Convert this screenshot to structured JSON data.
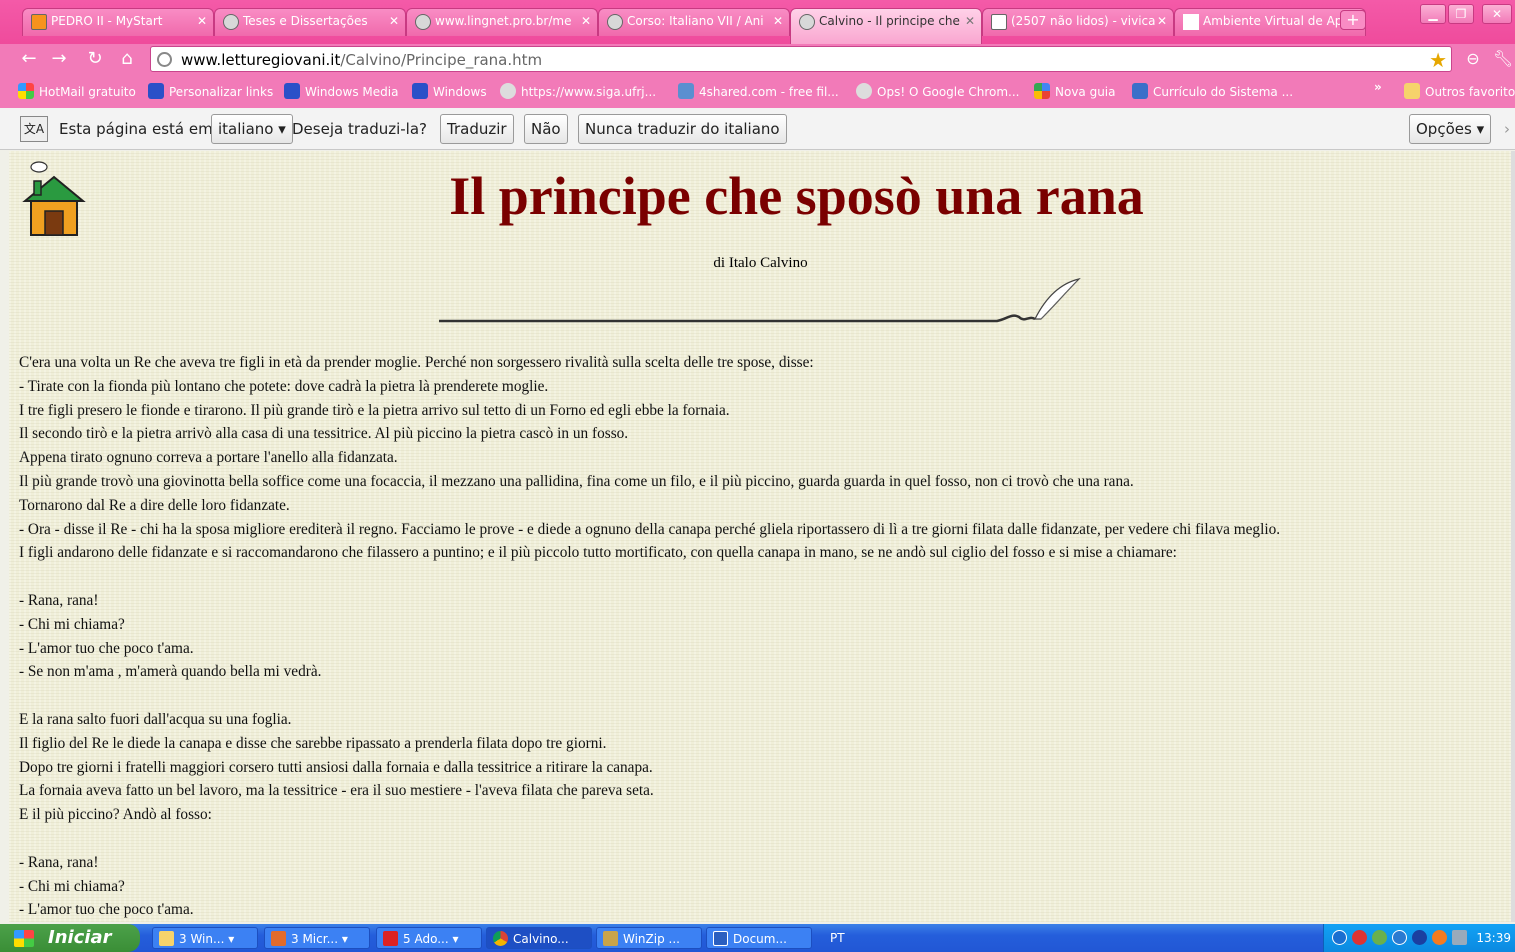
{
  "browser": {
    "tabs": [
      {
        "label": "PEDRO II - MyStart",
        "active": false
      },
      {
        "label": "Teses e Dissertações",
        "active": false
      },
      {
        "label": "www.lingnet.pro.br/me",
        "active": false
      },
      {
        "label": "Corso: Italiano VII / Ani",
        "active": false
      },
      {
        "label": "Calvino - Il principe che",
        "active": true
      },
      {
        "label": "(2507 não lidos) - vivica",
        "active": false
      },
      {
        "label": "Ambiente Virtual de Apr",
        "active": false
      }
    ],
    "url_domain": "www.letturegiovani.it",
    "url_path": "/Calvino/Principe_rana.htm",
    "bookmarks": [
      "HotMail gratuito",
      "Personalizar links",
      "Windows Media",
      "Windows",
      "https://www.siga.ufrj...",
      "4shared.com - free fil...",
      "Ops! O Google Chrom...",
      "Nova guia",
      "Currículo do Sistema ...",
      "Outros favoritos"
    ],
    "bookmarks_more": "»"
  },
  "translate_bar": {
    "prefix": "Esta página está em",
    "language": "italiano",
    "question": "Deseja traduzi-la?",
    "translate_btn": "Traduzir",
    "no_btn": "Não",
    "never_btn": "Nunca traduzir do italiano",
    "options_btn": "Opções",
    "icon_text": "文A"
  },
  "page": {
    "title": "Il principe che sposò una rana",
    "author": "di Italo Calvino",
    "lines": [
      "C'era una volta un Re che aveva tre figli in età da prender moglie. Perché non sorgessero rivalità sulla scelta delle tre spose, disse:",
      "- Tirate con la fionda più lontano che potete: dove cadrà la pietra là prenderete moglie.",
      "I tre figli presero le fionde e tirarono. Il più grande tirò e la pietra arrivo sul tetto di un Forno ed egli ebbe la fornaia.",
      "Il secondo tirò e la pietra arrivò alla casa di una tessitrice. Al più piccino la pietra cascò in un fosso.",
      "Appena tirato ognuno correva a portare l'anello alla fidanzata.",
      "Il più grande trovò una giovinotta bella soffice come una focaccia, il mezzano una pallidina, fina come un filo, e il più piccino, guarda guarda in quel fosso, non ci trovò che una rana.",
      "Tornarono dal Re a dire delle loro fidanzate.",
      "- Ora - disse il Re - chi ha la sposa migliore erediterà il regno. Facciamo le prove - e diede a ognuno della canapa perché gliela riportassero di lì a tre giorni filata dalle fidanzate, per vedere chi filava meglio.",
      "I figli andarono delle fidanzate e si raccomandarono che filassero a puntino; e il più piccolo tutto mortificato, con quella canapa in mano, se ne andò sul ciglio del fosso e si mise a chiamare:",
      "",
      "- Rana, rana!",
      "- Chi mi chiama?",
      "- L'amor tuo che poco t'ama.",
      "- Se non m'ama , m'amerà quando bella mi vedrà.",
      "",
      "E la rana salto fuori dall'acqua su una foglia.",
      "Il figlio del Re le diede la canapa e disse che sarebbe ripassato a prenderla filata dopo tre giorni.",
      "Dopo tre giorni i fratelli maggiori corsero tutti ansiosi dalla fornaia e dalla tessitrice a ritirare la canapa.",
      "La fornaia aveva fatto un bel lavoro, ma la tessitrice - era il suo mestiere - l'aveva filata che pareva seta.",
      "E il più piccino? Andò al fosso:",
      "",
      "- Rana, rana!",
      "- Chi mi chiama?",
      "- L'amor tuo che poco t'ama."
    ]
  },
  "taskbar": {
    "start": "Iniciar",
    "tasks": [
      {
        "label": "3 Win...",
        "active": false
      },
      {
        "label": "3 Micr...",
        "active": false
      },
      {
        "label": "5 Ado...",
        "active": false
      },
      {
        "label": "Calvino...",
        "active": true
      },
      {
        "label": "WinZip ...",
        "active": false
      },
      {
        "label": "Docum...",
        "active": false
      }
    ],
    "language": "PT",
    "clock": "13:39"
  }
}
